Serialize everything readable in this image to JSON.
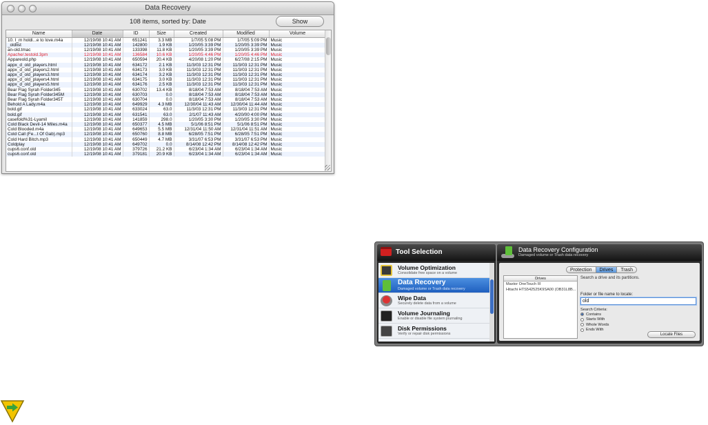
{
  "window": {
    "title": "Data Recovery",
    "count_text": "108 items, sorted by: Date",
    "show_button": "Show"
  },
  "table": {
    "columns": [
      "Name",
      "Date",
      "ID",
      "Size",
      "Created",
      "Modified",
      "Volume"
    ],
    "sorted_column": "Date",
    "rows": [
      [
        "10. I_m holdi...e to love.m4a",
        "12/19/08 10:41 AM",
        "651241",
        "3.3 MB",
        "1/7/05 5:08 PM",
        "1/7/05 5:09 PM",
        "Music"
      ],
      [
        "_oldlist",
        "12/19/08 10:41 AM",
        "142800",
        "1.9 KB",
        "1/20/05 3:39 PM",
        "1/20/05 3:39 PM",
        "Music"
      ],
      [
        "an-old.tmac",
        "12/19/08 10:41 AM",
        "133398",
        "11.8 KB",
        "1/20/05 3:39 PM",
        "1/20/05 3:39 PM",
        "Music"
      ],
      [
        "Apache/.testold.3pm",
        "12/19/08 10:41 AM",
        "136584",
        "10.6 KB",
        "1/20/05 4:46 PM",
        "1/20/05 4:46 PM",
        "Music"
      ],
      [
        "Appareold.php",
        "12/19/08 10:41 AM",
        "650594",
        "20.4 KB",
        "4/20/08 1:20 PM",
        "6/27/08 2:15 PM",
        "Music"
      ],
      [
        "appx_d_old_players.html",
        "12/19/08 10:41 AM",
        "634172",
        "2.1 KB",
        "11/3/03 12:31 PM",
        "11/3/03 12:31 PM",
        "Music"
      ],
      [
        "appx_d_old_players2.html",
        "12/19/08 10:41 AM",
        "634173",
        "3.0 KB",
        "11/3/03 12:31 PM",
        "11/3/03 12:31 PM",
        "Music"
      ],
      [
        "appx_d_old_players3.html",
        "12/19/08 10:41 AM",
        "634174",
        "3.2 KB",
        "11/3/03 12:31 PM",
        "11/3/03 12:31 PM",
        "Music"
      ],
      [
        "appx_d_old_players4.html",
        "12/19/08 10:41 AM",
        "634175",
        "3.0 KB",
        "11/3/03 12:31 PM",
        "11/3/03 12:31 PM",
        "Music"
      ],
      [
        "appx_d_old_players5.html",
        "12/19/08 10:41 AM",
        "634176",
        "2.5 KB",
        "11/3/03 12:31 PM",
        "11/3/03 12:31 PM",
        "Music"
      ],
      [
        "Bear Flag Syrah Folder345",
        "12/19/08 10:41 AM",
        "630702",
        "13.4 KB",
        "8/18/04 7:53 AM",
        "8/18/04 7:53 AM",
        "Music"
      ],
      [
        "Bear Flag Syrah Folder345M",
        "12/19/08 10:41 AM",
        "630703",
        "0.0",
        "8/18/04 7:53 AM",
        "8/18/04 7:53 AM",
        "Music"
      ],
      [
        "Bear Flag Syrah Folder345T",
        "12/19/08 10:41 AM",
        "630704",
        "0.0",
        "8/18/04 7:53 AM",
        "8/18/04 7:53 AM",
        "Music"
      ],
      [
        "Behold A Lady.m4a",
        "12/19/08 10:41 AM",
        "649929",
        "4.3 MB",
        "12/30/04 11:43 AM",
        "12/30/04 11:44 AM",
        "Music"
      ],
      [
        "bold.gif",
        "12/19/08 10:41 AM",
        "633024",
        "63.0",
        "11/3/03 12:31 PM",
        "11/3/03 12:31 PM",
        "Music"
      ],
      [
        "bold.gif",
        "12/19/08 10:41 AM",
        "631541",
        "63.0",
        "2/1/07 11:43 AM",
        "4/20/00 4:00 PM",
        "Music"
      ],
      [
        "casefold%31-Lyamil",
        "12/19/08 10:41 AM",
        "141859",
        "298.0",
        "1/20/05 3:30 PM",
        "1/20/05 3:30 PM",
        "Music"
      ],
      [
        "Cold Black Devil-14 Miles.m4a",
        "12/19/08 10:41 AM",
        "650377",
        "4.5 MB",
        "5/1/06 8:51 PM",
        "5/1/06 8:51 PM",
        "Music"
      ],
      [
        "Cold Blooded.m4a",
        "12/19/08 10:41 AM",
        "649653",
        "5.5 MB",
        "12/31/04 11:50 AM",
        "12/31/04 11:51 AM",
        "Music"
      ],
      [
        "Cold Call (Fe...t Of Gab).mp3",
        "12/19/08 10:41 AM",
        "650760",
        "8.8 MB",
        "6/28/05 7:51 PM",
        "6/28/05 7:51 PM",
        "Music"
      ],
      [
        "Cold Hard Bitch.mp3",
        "12/19/08 10:41 AM",
        "650449",
        "4.7 MB",
        "3/31/07 6:53 PM",
        "3/31/07 6:53 PM",
        "Music"
      ],
      [
        "Coldplay",
        "12/19/08 10:41 AM",
        "649702",
        "0.0",
        "8/14/08 12:42 PM",
        "8/14/08 12:42 PM",
        "Music"
      ],
      [
        "cups6.conf.old",
        "12/19/08 10:41 AM",
        "379726",
        "21.2 KB",
        "6/23/04 1:34 AM",
        "6/23/04 1:34 AM",
        "Music"
      ],
      [
        "cups6.conf.old",
        "12/19/08 10:41 AM",
        "379181",
        "20.9 KB",
        "6/23/04 1:34 AM",
        "6/23/04 1:34 AM",
        "Music"
      ]
    ]
  },
  "tool_selection": {
    "title": "Tool Selection",
    "items": [
      {
        "title": "Volume Optimization",
        "desc": "Consolidate free space on a volume"
      },
      {
        "title": "Data Recovery",
        "desc": "Damaged volume or Trash data recovery"
      },
      {
        "title": "Wipe Data",
        "desc": "Securely delete data from a volume"
      },
      {
        "title": "Volume Journaling",
        "desc": "Enable or disable file system journaling"
      },
      {
        "title": "Disk Permissions",
        "desc": "Verify or repair disk permissions"
      }
    ]
  },
  "config": {
    "title": "Data Recovery Configuration",
    "subtitle": "Damaged volume or Trash data recovery",
    "tabs": [
      "Protection",
      "Drives",
      "Trash"
    ],
    "active_tab": "Drives",
    "drives_header": "Drives",
    "drives": [
      "Maxtor OneTouch III",
      "Hitachi HTS542525K9SA00 (OB31L8B..."
    ],
    "hint": "Search a drive and its partitions.",
    "field_label": "Folder or file name to locate:",
    "field_value": "old",
    "criteria_label": "Search Criteria:",
    "criteria": [
      "Contains",
      "Starts With",
      "Whole Words",
      "Ends With"
    ],
    "locate_button": "Locate Files"
  },
  "colors": {
    "selection_blue": "#2f73d2",
    "alt_row": "#edf3fe",
    "deleted_red": "#e0202a",
    "sign_yellow": "#f2c400",
    "sign_green": "#3aa33a"
  }
}
